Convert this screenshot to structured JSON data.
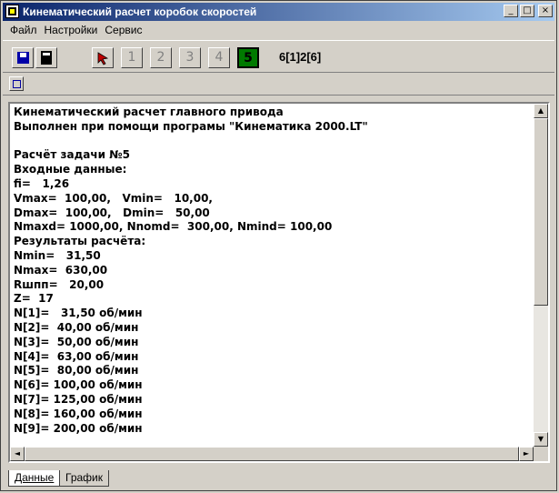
{
  "window": {
    "title": "Кинематический расчет коробок скоростей"
  },
  "title_buttons": {
    "minimize": "_",
    "maximize": "□",
    "close": "×"
  },
  "menu": [
    "Файл",
    "Настройки",
    "Сервис"
  ],
  "toolbar": {
    "icons": [
      "save-icon",
      "calculator-icon",
      "cursor-arrow-icon"
    ],
    "steps": [
      "1",
      "2",
      "3",
      "4",
      "5"
    ],
    "active_step": "5",
    "sequence": "6[1]2[6]"
  },
  "report": {
    "lines": [
      "Кинематический расчет главного привода",
      "Выполнен при помощи програмы \"Кинематика 2000.LT\"",
      "",
      "Расчёт задачи №5",
      "Входные данные:",
      "fi=   1,26",
      "Vmax=  100,00,   Vmin=   10,00,",
      "Dmax=  100,00,   Dmin=   50,00",
      "Nmaxd= 1000,00, Nnomd=  300,00, Nmind= 100,00",
      "Результаты расчёта:",
      "Nmin=   31,50",
      "Nmax=  630,00",
      "Rшпп=   20,00",
      "Z=  17",
      "N[1]=   31,50 об/мин",
      "N[2]=  40,00 об/мин",
      "N[3]=  50,00 об/мин",
      "N[4]=  63,00 об/мин",
      "N[5]=  80,00 об/мин",
      "N[6]= 100,00 об/мин",
      "N[7]= 125,00 об/мин",
      "N[8]= 160,00 об/мин",
      "N[9]= 200,00 об/мин"
    ]
  },
  "scroll": {
    "up": "▲",
    "down": "▼",
    "left": "◄",
    "right": "►"
  },
  "tabs": [
    "Данные",
    "График"
  ]
}
